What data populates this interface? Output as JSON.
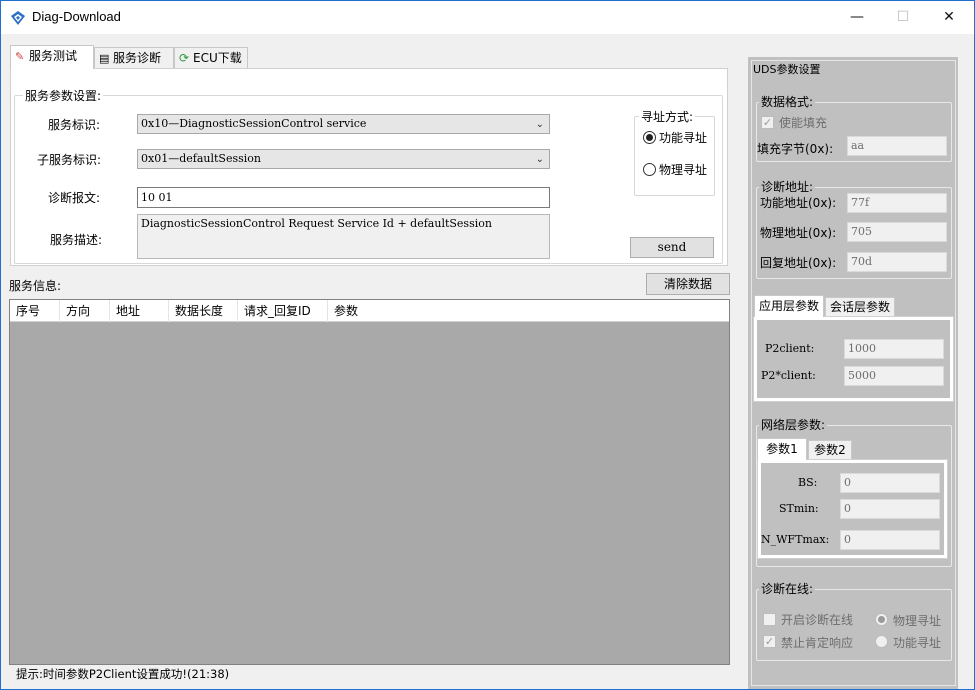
{
  "window": {
    "title": "Diag-Download",
    "minimize": "—",
    "maximize": "☐",
    "close": "✕"
  },
  "tabs": [
    {
      "label": "服务测试",
      "icon": "wrench-icon"
    },
    {
      "label": "服务诊断",
      "icon": "document-icon"
    },
    {
      "label": "ECU下载",
      "icon": "refresh-icon"
    }
  ],
  "service_params": {
    "group_label": "服务参数设置:",
    "service_id_label": "服务标识:",
    "service_id_value": "0x10—DiagnosticSessionControl service",
    "subservice_label": "子服务标识:",
    "subservice_value": "0x01—defaultSession",
    "diag_msg_label": "诊断报文:",
    "diag_msg_value": "10 01",
    "desc_label": "服务描述:",
    "desc_value": "DiagnosticSessionControl Request Service Id + defaultSession"
  },
  "addressing": {
    "group_label": "寻址方式:",
    "functional": "功能寻址",
    "physical": "物理寻址",
    "selected": "functional"
  },
  "send_button": "send",
  "service_info": {
    "label": "服务信息:",
    "clear_button": "清除数据",
    "columns": [
      "序号",
      "方向",
      "地址",
      "数据长度",
      "请求_回复ID",
      "参数"
    ]
  },
  "status_text": "提示:时间参数P2Client设置成功!(21:38)",
  "uds": {
    "title": "UDS参数设置",
    "data_format": {
      "label": "数据格式:",
      "enable_fill": "使能填充",
      "fill_byte_label": "填充字节(0x):",
      "fill_byte_value": "aa"
    },
    "diag_address": {
      "label": "诊断地址:",
      "func_label": "功能地址(0x):",
      "func_value": "77f",
      "phys_label": "物理地址(0x):",
      "phys_value": "705",
      "reply_label": "回复地址(0x):",
      "reply_value": "70d"
    },
    "layer_tabs": [
      "应用层参数",
      "会话层参数"
    ],
    "app_layer": {
      "p2client_label": "P2client:",
      "p2client_value": "1000",
      "p2star_label": "P2*client:",
      "p2star_value": "5000"
    },
    "network": {
      "label": "网络层参数:",
      "tabs": [
        "参数1",
        "参数2"
      ],
      "bs_label": "BS:",
      "bs_value": "0",
      "stmin_label": "STmin:",
      "stmin_value": "0",
      "nwft_label": "N_WFTmax:",
      "nwft_value": "0"
    },
    "online": {
      "label": "诊断在线:",
      "start_online": "开启诊断在线",
      "phys_addr": "物理寻址",
      "disable_pos": "禁止肯定响应",
      "func_addr": "功能寻址"
    }
  }
}
